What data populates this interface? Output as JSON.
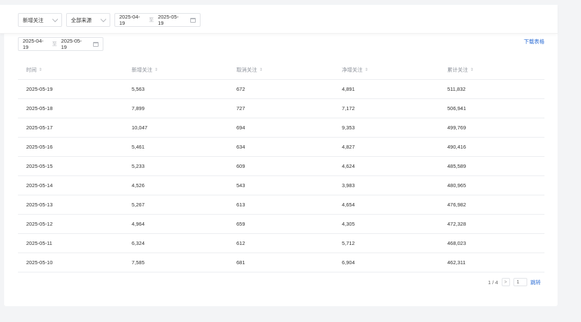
{
  "filters": {
    "type_select": "新增关注",
    "source_select": "全部来源",
    "top_range": {
      "start": "2025-04-19",
      "sep": "至",
      "end": "2025-05-19"
    }
  },
  "table_range": {
    "start": "2025-04-19",
    "sep": "至",
    "end": "2025-05-19"
  },
  "download_label": "下载表格",
  "table": {
    "columns": [
      "时间",
      "新增关注",
      "取消关注",
      "净增关注",
      "累计关注"
    ],
    "sort_glyph": "⇕",
    "rows": [
      [
        "2025-05-19",
        "5,563",
        "672",
        "4,891",
        "511,832"
      ],
      [
        "2025-05-18",
        "7,899",
        "727",
        "7,172",
        "506,941"
      ],
      [
        "2025-05-17",
        "10,047",
        "694",
        "9,353",
        "499,769"
      ],
      [
        "2025-05-16",
        "5,461",
        "634",
        "4,827",
        "490,416"
      ],
      [
        "2025-05-15",
        "5,233",
        "609",
        "4,624",
        "485,589"
      ],
      [
        "2025-05-14",
        "4,526",
        "543",
        "3,983",
        "480,965"
      ],
      [
        "2025-05-13",
        "5,267",
        "613",
        "4,654",
        "476,982"
      ],
      [
        "2025-05-12",
        "4,964",
        "659",
        "4,305",
        "472,328"
      ],
      [
        "2025-05-11",
        "6,324",
        "612",
        "5,712",
        "468,023"
      ],
      [
        "2025-05-10",
        "7,585",
        "681",
        "6,904",
        "462,311"
      ]
    ]
  },
  "pagination": {
    "page_info": "1 / 4",
    "next_glyph": ">",
    "input_value": "1",
    "jump_label": "跳转"
  },
  "colors": {
    "accent": "#2f6fd6",
    "border": "#eceef1",
    "page_bg": "#f3f4f6"
  }
}
